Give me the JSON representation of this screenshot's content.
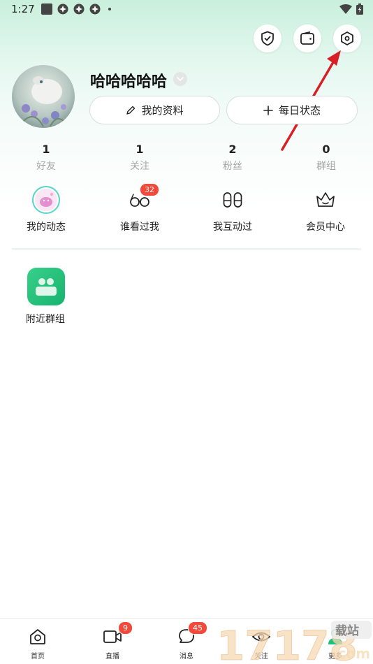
{
  "status_bar": {
    "time": "1:27"
  },
  "profile": {
    "username": "哈哈哈哈哈",
    "edit_profile_label": "我的资料",
    "daily_status_label": "每日状态"
  },
  "stats": [
    {
      "value": "1",
      "label": "好友"
    },
    {
      "value": "1",
      "label": "关注"
    },
    {
      "value": "2",
      "label": "粉丝"
    },
    {
      "value": "0",
      "label": "群组"
    }
  ],
  "features": [
    {
      "label": "我的动态",
      "icon": "my-moments-avatar-icon"
    },
    {
      "label": "谁看过我",
      "icon": "glasses-icon",
      "badge": "32"
    },
    {
      "label": "我互动过",
      "icon": "footprints-icon"
    },
    {
      "label": "会员中心",
      "icon": "crown-icon"
    }
  ],
  "apps": [
    {
      "label": "附近群组",
      "icon": "nearby-groups-icon"
    }
  ],
  "bottom_nav": [
    {
      "label": "首页",
      "icon": "home-icon"
    },
    {
      "label": "直播",
      "icon": "video-camera-icon",
      "badge": "9"
    },
    {
      "label": "消息",
      "icon": "chat-bubble-icon",
      "badge": "45"
    },
    {
      "label": "关注",
      "icon": "eye-icon"
    },
    {
      "label": "更多",
      "icon": "person-icon"
    }
  ],
  "watermark": {
    "text": "17178",
    "suffix": ".com",
    "tag": "载站"
  },
  "colors": {
    "accent_green": "#21c07a",
    "badge_red": "#f2493a",
    "annotation_arrow": "#d81f26"
  }
}
